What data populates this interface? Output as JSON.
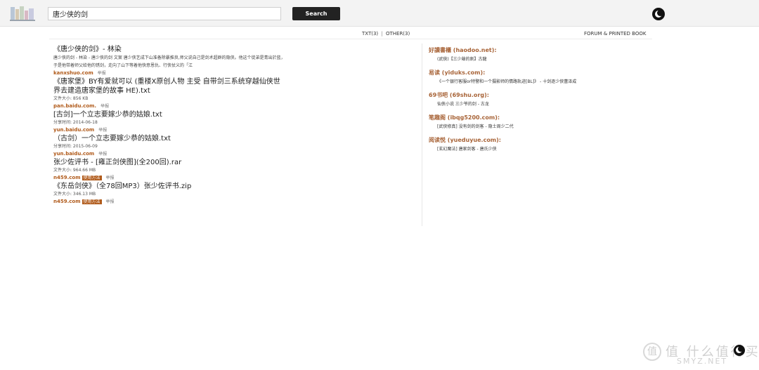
{
  "search": {
    "query": "唐少侠的剑",
    "button_label": "Search"
  },
  "filters": {
    "txt": "TXT(3)",
    "separator": "|",
    "other": "OTHER(3)"
  },
  "forum_link": "FORUM & PRINTED BOOK",
  "results": [
    {
      "title": "《唐少侠的剑》- 林染",
      "snippet": "唐少侠的剑 - 林染 - 唐少侠的剑 文案 唐少侠艺成下山准备除暴推良,师父说自己是剑术超群的隐侠。他这个徒弟是青出於蓝，于是他带着师父给他的锈剑，走向了山下等着他快意恩仇、行侠仗义的「江",
      "meta": "",
      "source": "kanxshuo.com",
      "badge": "",
      "report": "举报"
    },
    {
      "title": "《唐家堡》BY有爱就可以 (重楼X原创人物 主受 自带剑三系统穿越仙侠世界去建造唐家堡的故事 HE).txt",
      "snippet": "",
      "meta": "文件大小: 856 KB",
      "source": "pan.baidu.com.",
      "badge": "",
      "report": "举报"
    },
    {
      "title": "[古剑]一个立志要嫁少恭的姑娘.txt",
      "snippet": "",
      "meta": "分享时间: 2014-06-18",
      "source": "yun.baidu.com",
      "badge": "",
      "report": "举报"
    },
    {
      "title": "（古剑）一个立志要嫁少恭的姑娘.txt",
      "snippet": "",
      "meta": "分享时间: 2015-06-09",
      "source": "yun.baidu.com",
      "badge": "",
      "report": "举报"
    },
    {
      "title": "张少佐评书 - [雍正剑侠图](全200回).rar",
      "snippet": "",
      "meta": "文件大小: 964.66 MB",
      "source": "n459.com",
      "badge": "使用方法",
      "report": "举报"
    },
    {
      "title": "《东岳剑侠》（全78回MP3）张少佐评书.zip",
      "snippet": "",
      "meta": "文件大小: 346.13 MB",
      "source": "n459.com",
      "badge": "使用方法",
      "report": "举报"
    }
  ],
  "sites": [
    {
      "name": "好讀書櫃 (haodoo.net):",
      "item": "(武俠)【三少爺的劍】古龍"
    },
    {
      "name": "易读 (yiduks.com):",
      "item": "《一个银行客服or特警和一个摄影师的情路轨迹[BL]》 - 十剑逐少侠蕾泽成"
    },
    {
      "name": "69书吧 (69shu.org):",
      "item": "仙侠小说 三少爷的剑 - 古龙"
    },
    {
      "name": "笔趣阁 (ibqg5200.com):",
      "item": "[武侠修真] 没有剑的剑客 - 隐士周少二代"
    },
    {
      "name": "阅读悦 (yueduyue.com):",
      "item": "[玄幻魔法] 唐家剑客 - 唐氏少侠"
    }
  ],
  "watermark": {
    "text": "值 什么值得买",
    "sub": "SMYZ.NET"
  },
  "colors": {
    "accent": "#b05a1a",
    "site_heading": "#a86438",
    "button": "#222222",
    "topbar": "#f3f3f3"
  },
  "icons": {
    "logo": "bookshelf-logo-icon",
    "mode_toggle": "moon-icon",
    "watermark": "zhi-logo-icon"
  }
}
